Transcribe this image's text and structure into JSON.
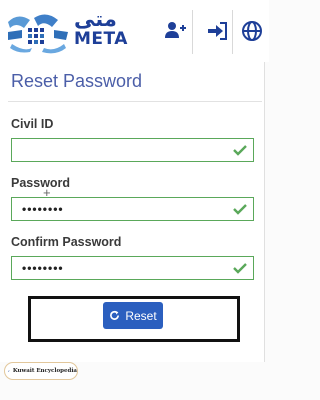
{
  "header": {
    "logo_ar": "متى",
    "logo_en": "META",
    "icons": [
      "add-user-icon",
      "login-icon",
      "globe-icon"
    ]
  },
  "form": {
    "title": "Reset Password",
    "fields": [
      {
        "label": "Civil ID",
        "value": ""
      },
      {
        "label": "Password",
        "value": "••••••••"
      },
      {
        "label": "Confirm Password",
        "value": "••••••••"
      }
    ],
    "reset_label": "Reset"
  },
  "watermark": {
    "text": "Kuwait Encyclopedia"
  },
  "colors": {
    "brand": "#1e3f98",
    "title": "#4b5ea8",
    "valid": "#5aa85a",
    "button": "#2b5fbf"
  }
}
